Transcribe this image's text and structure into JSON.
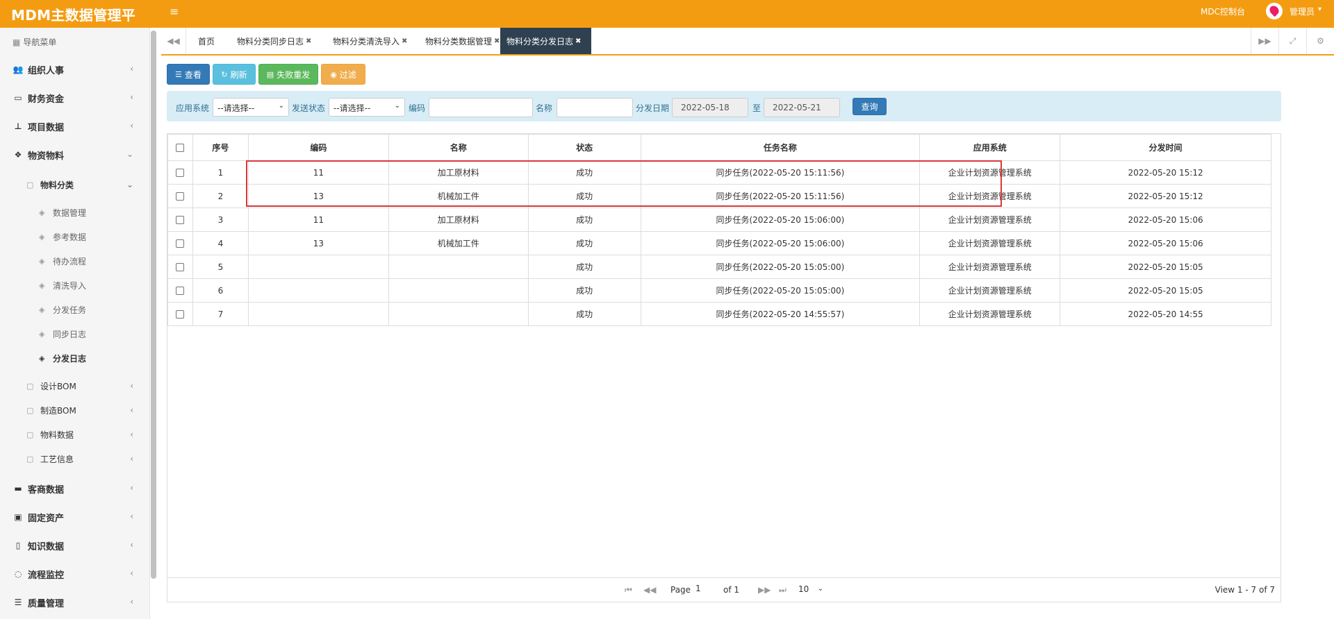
{
  "header": {
    "brand": "MDM主数据管理平台",
    "menu_toggle": "≡",
    "console_link": "MDC控制台",
    "user_name": "管理员",
    "user_caret": "▾"
  },
  "sidebar": {
    "nav_header": "导航菜单",
    "menus": [
      {
        "label": "组织人事",
        "icon": "users-icon"
      },
      {
        "label": "财务资金",
        "icon": "credit-card-icon"
      },
      {
        "label": "项目数据",
        "icon": "sitemap-icon"
      },
      {
        "label": "物资物料",
        "icon": "cubes-icon"
      },
      {
        "label": "客商数据",
        "icon": "briefcase-icon"
      },
      {
        "label": "固定资产",
        "icon": "archive-icon"
      },
      {
        "label": "知识数据",
        "icon": "file-icon"
      },
      {
        "label": "流程监控",
        "icon": "spinner-icon"
      },
      {
        "label": "质量管理",
        "icon": "list-icon"
      }
    ],
    "sub_menus": [
      {
        "label": "物料分类"
      },
      {
        "label": "设计BOM"
      },
      {
        "label": "制造BOM"
      },
      {
        "label": "物料数据"
      },
      {
        "label": "工艺信息"
      }
    ],
    "leaf_items": [
      {
        "label": "数据管理"
      },
      {
        "label": "参考数据"
      },
      {
        "label": "待办流程"
      },
      {
        "label": "清洗导入"
      },
      {
        "label": "分发任务"
      },
      {
        "label": "同步日志"
      },
      {
        "label": "分发日志"
      }
    ]
  },
  "tabs": {
    "home": "首页",
    "items": [
      {
        "label": "物料分类同步日志"
      },
      {
        "label": "物料分类清洗导入"
      },
      {
        "label": "物料分类数据管理"
      },
      {
        "label": "物料分类分发日志"
      }
    ]
  },
  "toolbar": {
    "view": "查看",
    "refresh": "刷新",
    "resend": "失败重发",
    "filter": "过滤"
  },
  "search": {
    "app_system_label": "应用系统",
    "app_system_value": "--请选择--",
    "send_status_label": "发送状态",
    "send_status_value": "--请选择--",
    "code_label": "编码",
    "name_label": "名称",
    "date_label": "分发日期",
    "date_from": "2022-05-18",
    "date_to_label": "至",
    "date_to": "2022-05-21",
    "query": "查询"
  },
  "table": {
    "columns": [
      "序号",
      "编码",
      "名称",
      "状态",
      "任务名称",
      "应用系统",
      "分发时间"
    ],
    "rows": [
      {
        "no": "1",
        "code": "11",
        "name": "加工原材料",
        "status": "成功",
        "task": "同步任务(2022-05-20 15:11:56)",
        "system": "企业计划资源管理系统",
        "time": "2022-05-20 15:12"
      },
      {
        "no": "2",
        "code": "13",
        "name": "机械加工件",
        "status": "成功",
        "task": "同步任务(2022-05-20 15:11:56)",
        "system": "企业计划资源管理系统",
        "time": "2022-05-20 15:12"
      },
      {
        "no": "3",
        "code": "11",
        "name": "加工原材料",
        "status": "成功",
        "task": "同步任务(2022-05-20 15:06:00)",
        "system": "企业计划资源管理系统",
        "time": "2022-05-20 15:06"
      },
      {
        "no": "4",
        "code": "13",
        "name": "机械加工件",
        "status": "成功",
        "task": "同步任务(2022-05-20 15:06:00)",
        "system": "企业计划资源管理系统",
        "time": "2022-05-20 15:06"
      },
      {
        "no": "5",
        "code": "",
        "name": "",
        "status": "成功",
        "task": "同步任务(2022-05-20 15:05:00)",
        "system": "企业计划资源管理系统",
        "time": "2022-05-20 15:05"
      },
      {
        "no": "6",
        "code": "",
        "name": "",
        "status": "成功",
        "task": "同步任务(2022-05-20 15:05:00)",
        "system": "企业计划资源管理系统",
        "time": "2022-05-20 15:05"
      },
      {
        "no": "7",
        "code": "",
        "name": "",
        "status": "成功",
        "task": "同步任务(2022-05-20 14:55:57)",
        "system": "企业计划资源管理系统",
        "time": "2022-05-20 14:55"
      }
    ]
  },
  "pager": {
    "page_label": "Page",
    "page_value": "1",
    "of_label": "of 1",
    "page_size": "10",
    "view_text": "View 1 - 7 of 7"
  },
  "colors": {
    "header_bg": "#f39c12",
    "active_tab_bg": "#2f4050",
    "highlight_border": "#d9383a",
    "search_panel_bg": "#d9edf7"
  }
}
